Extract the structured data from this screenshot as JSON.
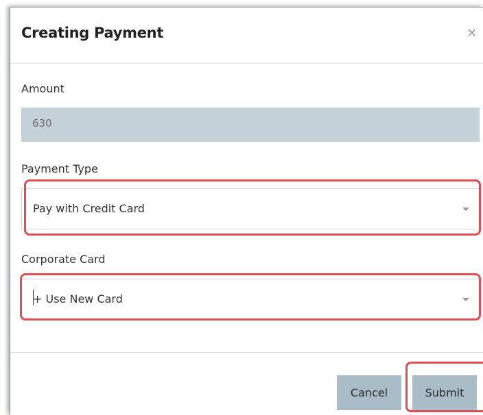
{
  "dialog": {
    "title": "Creating Payment",
    "close_icon": "×"
  },
  "amount": {
    "label": "Amount",
    "value": "630"
  },
  "payment_type": {
    "label": "Payment Type",
    "selected": "Pay with Credit Card"
  },
  "corporate_card": {
    "label": "Corporate Card",
    "selected": "+ Use New Card"
  },
  "footer": {
    "cancel_label": "Cancel",
    "submit_label": "Submit"
  },
  "colors": {
    "highlight": "#e04e55",
    "button_bg": "#a9bcc7",
    "readonly_bg": "#c4d1d9"
  }
}
